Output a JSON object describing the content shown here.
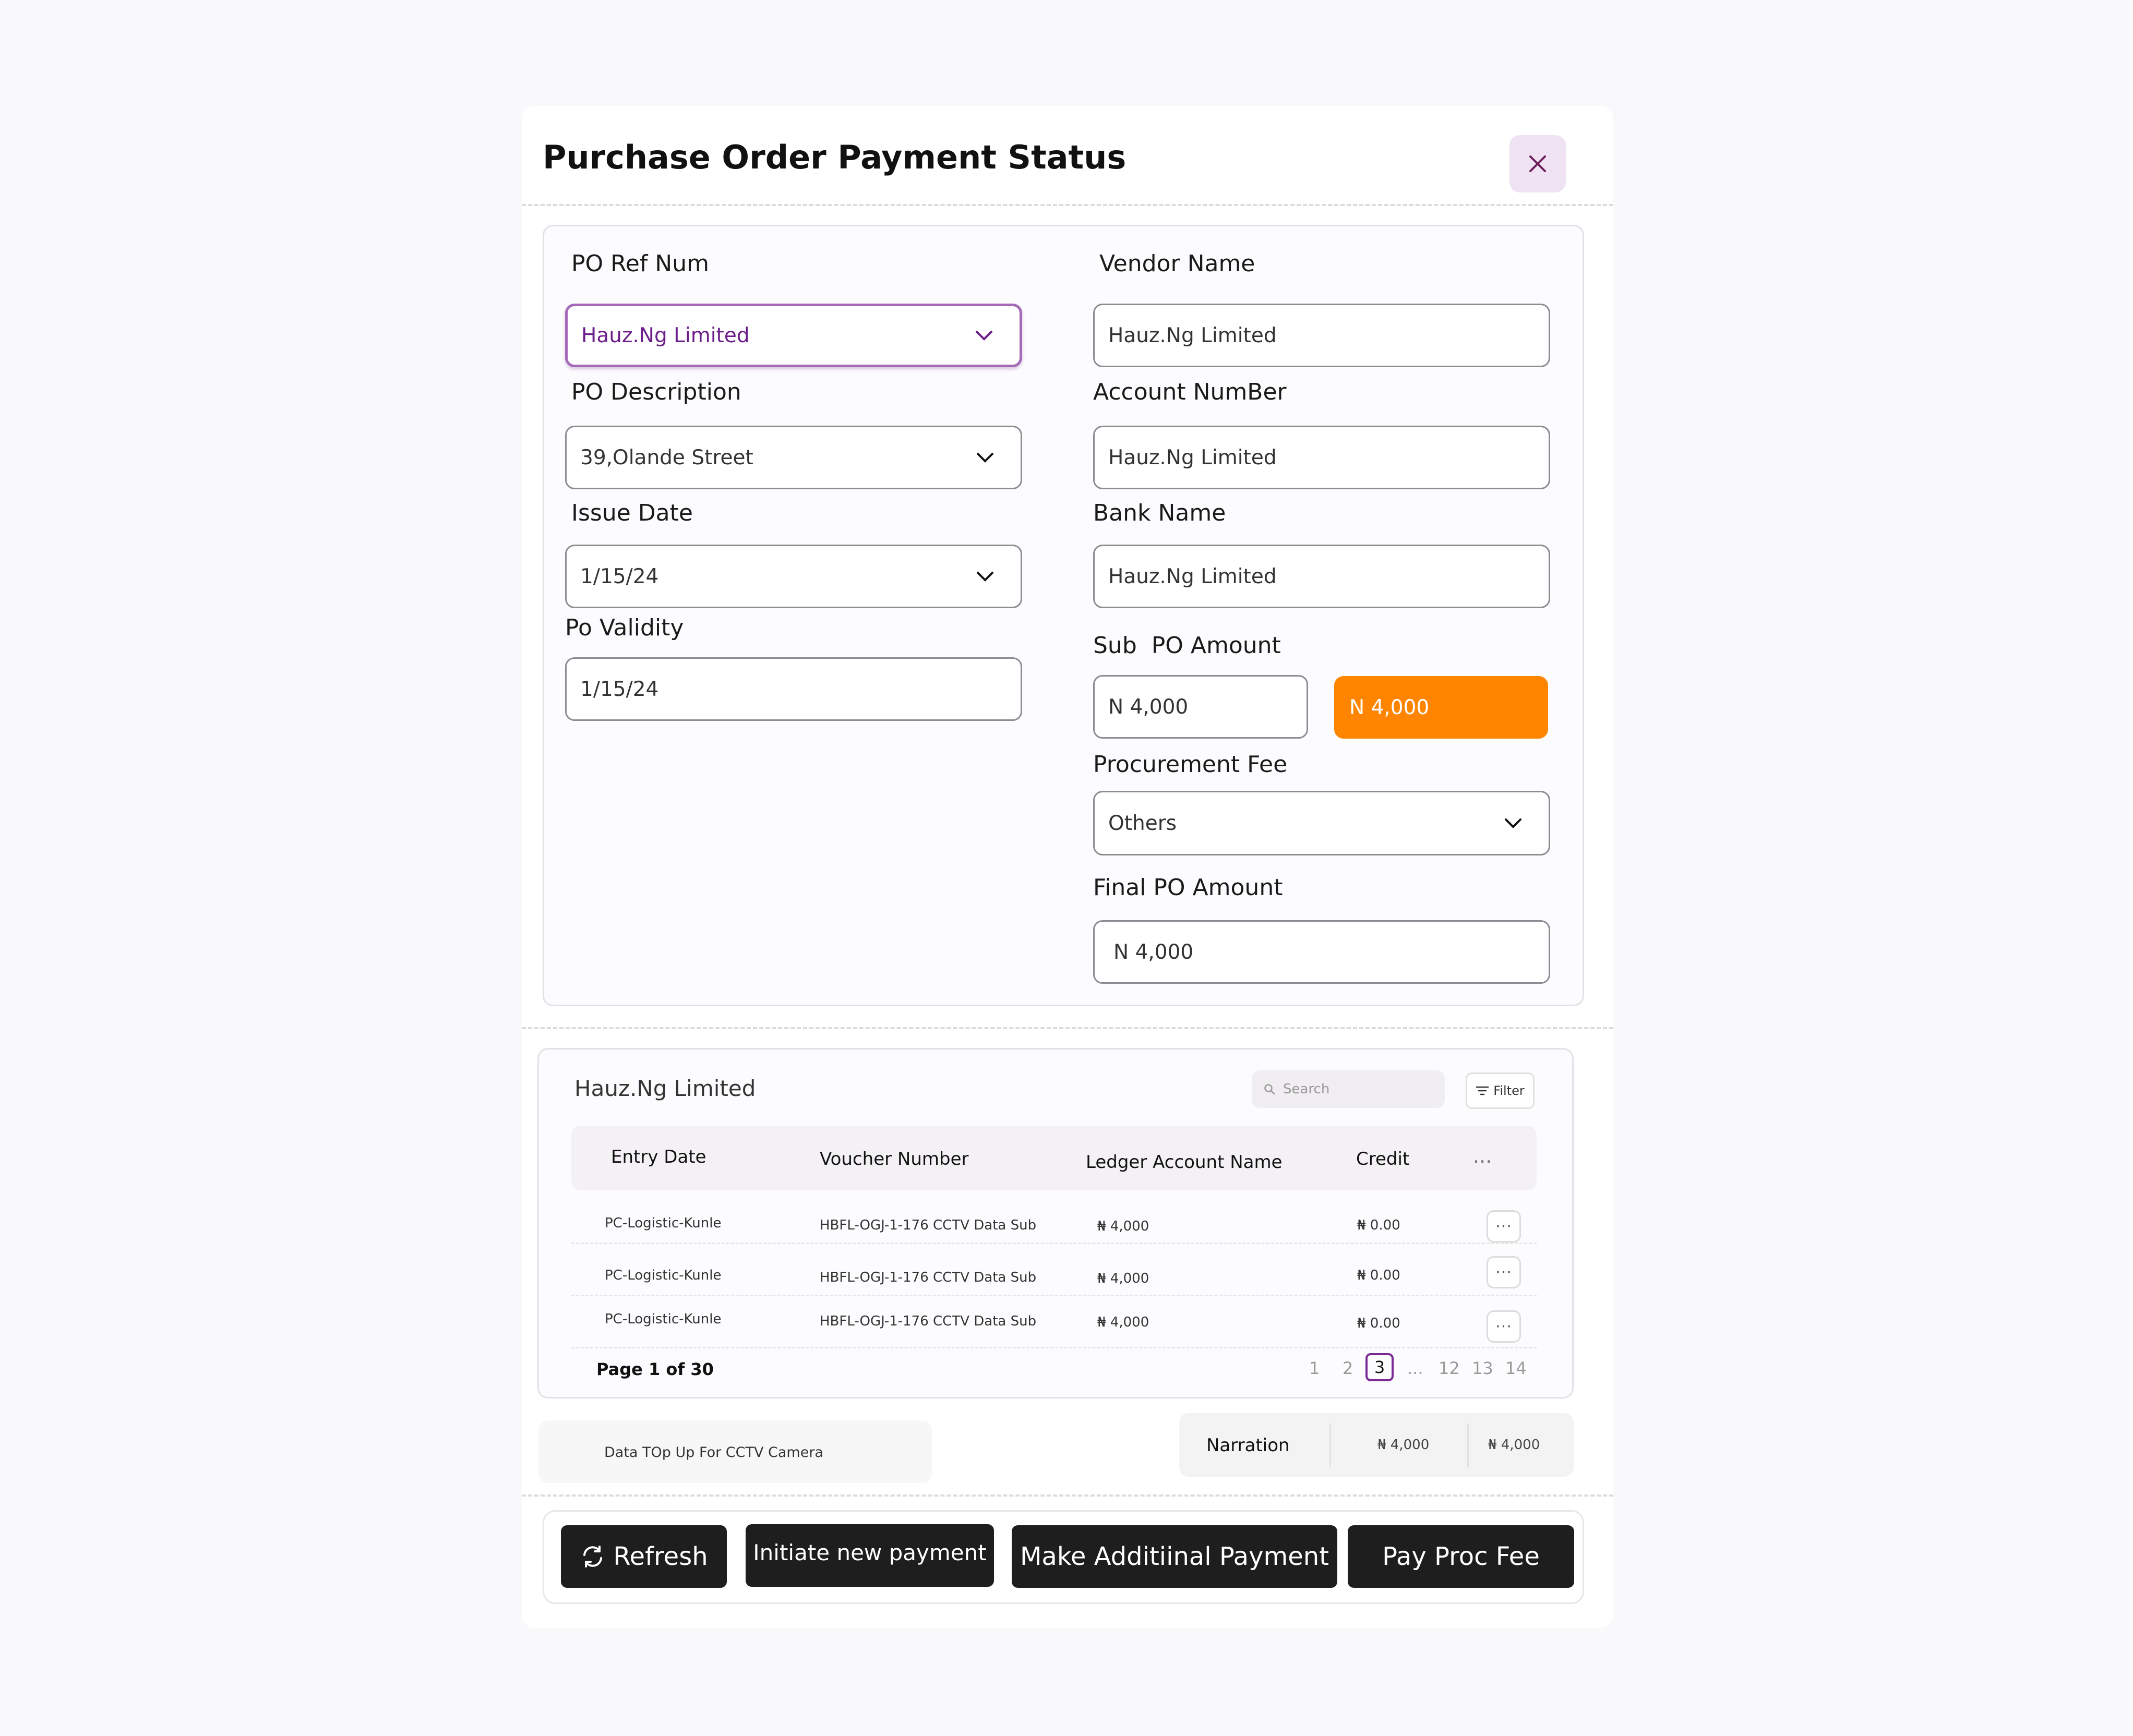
{
  "modal": {
    "title": "Purchase Order Payment Status"
  },
  "form": {
    "po_ref_num": {
      "label": "PO Ref Num",
      "value": "Hauz.Ng Limited"
    },
    "po_description": {
      "label": "PO Description",
      "value": "39,Olande Street"
    },
    "issue_date": {
      "label": "Issue Date",
      "value": "1/15/24"
    },
    "po_validity": {
      "label": "Po Validity",
      "value": "1/15/24"
    },
    "vendor_name": {
      "label": "Vendor Name",
      "value": "Hauz.Ng Limited"
    },
    "account_number": {
      "label": "Account NumBer",
      "value": "Hauz.Ng Limited"
    },
    "bank_name": {
      "label": "Bank Name",
      "value": "Hauz.Ng Limited"
    },
    "sub_po_amount": {
      "label": "Sub  PO Amount",
      "value": "N 4,000",
      "highlight_value": "N 4,000"
    },
    "procurement_fee": {
      "label": "Procurement Fee",
      "value": "Others"
    },
    "final_po_amount": {
      "label": "Final PO Amount",
      "value": "N 4,000"
    }
  },
  "ledger": {
    "title": "Hauz.Ng Limited",
    "search_placeholder": "Search",
    "filter_label": "Filter",
    "columns": [
      "Entry Date",
      "Voucher Number",
      "Ledger Account Name",
      "Credit",
      "..."
    ],
    "rows": [
      {
        "entry_date": "PC-Logistic-Kunle",
        "voucher": "HBFL-OGJ-1-176 CCTV Data Sub",
        "ledger": "₦ 4,000",
        "credit": "₦ 0.00"
      },
      {
        "entry_date": "PC-Logistic-Kunle",
        "voucher": "HBFL-OGJ-1-176 CCTV Data Sub",
        "ledger": "₦ 4,000",
        "credit": "₦ 0.00"
      },
      {
        "entry_date": "PC-Logistic-Kunle",
        "voucher": "HBFL-OGJ-1-176 CCTV Data Sub",
        "ledger": "₦ 4,000",
        "credit": "₦ 0.00"
      }
    ],
    "row_action": "···",
    "page_info": "Page 1 of 30",
    "pages": [
      "1",
      "2",
      "3",
      "...",
      "12",
      "13",
      "14"
    ],
    "current_page": "3"
  },
  "narration": {
    "description": "Data TOp Up For CCTV Camera",
    "label": "Narration",
    "value1": "₦ 4,000",
    "value2": "₦ 4,000"
  },
  "actions": {
    "refresh": "Refresh",
    "initiate": "Initiate new payment",
    "additional": "Make Additiinal Payment",
    "pay_proc": "Pay Proc Fee"
  },
  "colors": {
    "accent_purple": "#7a2a95",
    "orange": "#ff8500",
    "button_dark": "#1e1e1e"
  }
}
